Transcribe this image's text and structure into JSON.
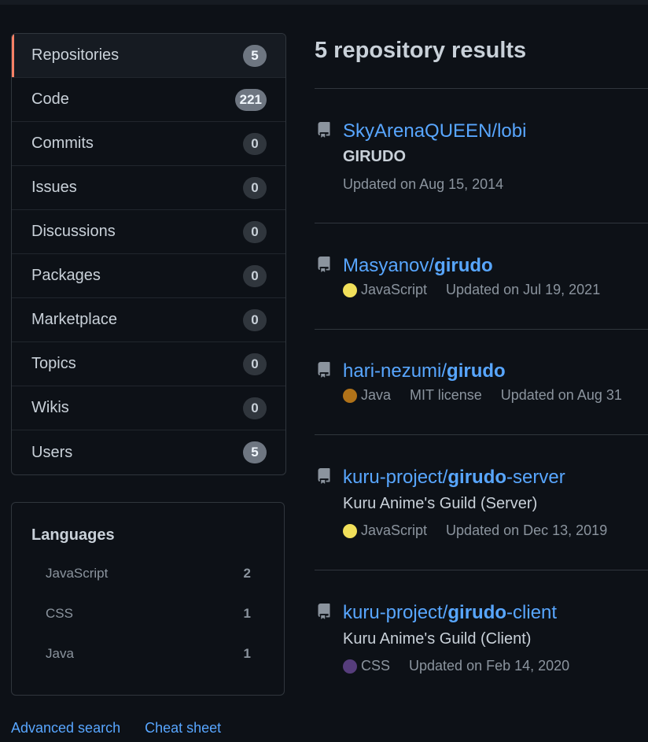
{
  "nav": {
    "items": [
      {
        "label": "Repositories",
        "count": "5",
        "selected": true
      },
      {
        "label": "Code",
        "count": "221"
      },
      {
        "label": "Commits",
        "count": "0"
      },
      {
        "label": "Issues",
        "count": "0"
      },
      {
        "label": "Discussions",
        "count": "0"
      },
      {
        "label": "Packages",
        "count": "0"
      },
      {
        "label": "Marketplace",
        "count": "0"
      },
      {
        "label": "Topics",
        "count": "0"
      },
      {
        "label": "Wikis",
        "count": "0"
      },
      {
        "label": "Users",
        "count": "5"
      }
    ]
  },
  "languages": {
    "title": "Languages",
    "items": [
      {
        "name": "JavaScript",
        "count": "2"
      },
      {
        "name": "CSS",
        "count": "1"
      },
      {
        "name": "Java",
        "count": "1"
      }
    ]
  },
  "footer": {
    "advanced_search": "Advanced search",
    "cheat_sheet": "Cheat sheet"
  },
  "results": {
    "heading": "5 repository results",
    "repos": [
      {
        "owner": "SkyArenaQUEEN/",
        "name_bold": "",
        "name_rest": "lobi",
        "description": "GIRUDO",
        "language": "",
        "license": "",
        "updated": "Updated on Aug 15, 2014"
      },
      {
        "owner": "Masyanov/",
        "name_bold": "girudo",
        "name_rest": "",
        "description": "",
        "language": "JavaScript",
        "language_color": "#f1e05a",
        "license": "",
        "updated": "Updated on Jul 19, 2021"
      },
      {
        "owner": "hari-nezumi/",
        "name_bold": "girudo",
        "name_rest": "",
        "description": "",
        "language": "Java",
        "language_color": "#b07219",
        "license": "MIT license",
        "updated": "Updated on Aug 31"
      },
      {
        "owner": "kuru-project/",
        "name_bold": "girudo",
        "name_rest": "-server",
        "description": "Kuru Anime's Guild (Server)",
        "language": "JavaScript",
        "language_color": "#f1e05a",
        "license": "",
        "updated": "Updated on Dec 13, 2019"
      },
      {
        "owner": "kuru-project/",
        "name_bold": "girudo",
        "name_rest": "-client",
        "description": "Kuru Anime's Guild (Client)",
        "language": "CSS",
        "language_color": "#563d7c",
        "license": "",
        "updated": "Updated on Feb 14, 2020"
      }
    ]
  },
  "colors": {
    "accent": "#58a6ff",
    "selected_bar": "#f78166",
    "background": "#0d1117"
  },
  "icons": {
    "repo": "repo-icon"
  }
}
